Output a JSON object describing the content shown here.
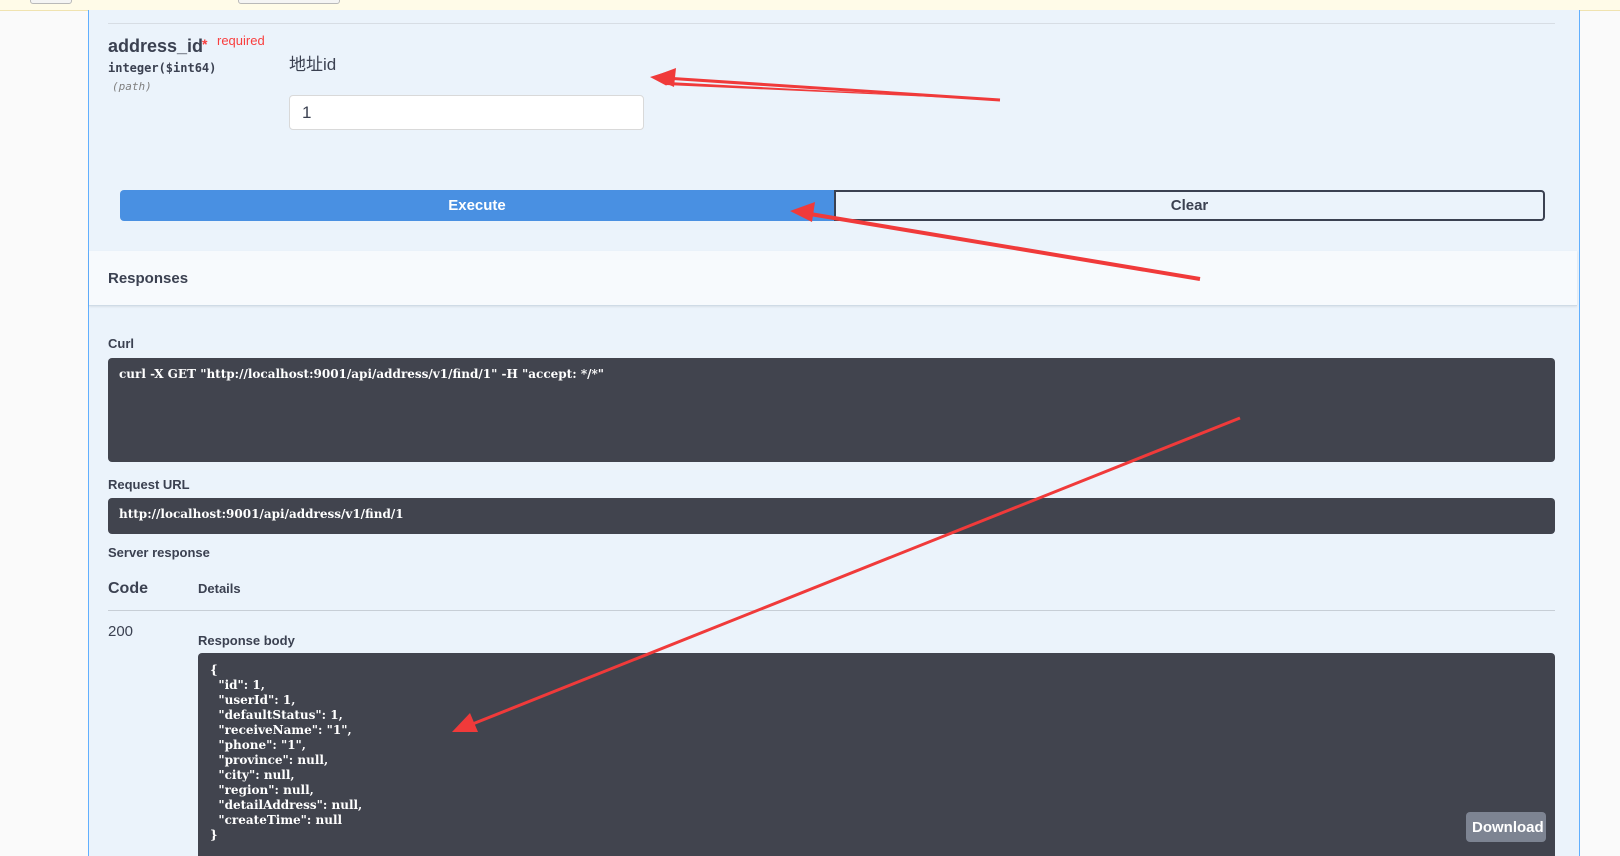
{
  "parameter": {
    "name": "address_id",
    "required_star": "*",
    "required_label": "required",
    "type": "integer($int64)",
    "location": "(path)",
    "description": "地址id",
    "value": "1"
  },
  "buttons": {
    "execute": "Execute",
    "clear": "Clear",
    "download": "Download"
  },
  "responses": {
    "title": "Responses",
    "curl_label": "Curl",
    "curl_command": "curl -X GET \"http://localhost:9001/api/address/v1/find/1\" -H \"accept: */*\"",
    "request_url_label": "Request URL",
    "request_url": "http://localhost:9001/api/address/v1/find/1",
    "server_response_label": "Server response",
    "code_header": "Code",
    "details_header": "Details",
    "status_code": "200",
    "response_body_label": "Response body",
    "response_body": "{\n  \"id\": 1,\n  \"userId\": 1,\n  \"defaultStatus\": 1,\n  \"receiveName\": \"1\",\n  \"phone\": \"1\",\n  \"province\": null,\n  \"city\": null,\n  \"region\": null,\n  \"detailAddress\": null,\n  \"createTime\": null\n}"
  },
  "colors": {
    "execute": "#4990e2",
    "panel": "#ebf3fb",
    "code_bg": "#41444e",
    "required": "#f93e3e",
    "annotation_arrow": "#f03a3a"
  }
}
